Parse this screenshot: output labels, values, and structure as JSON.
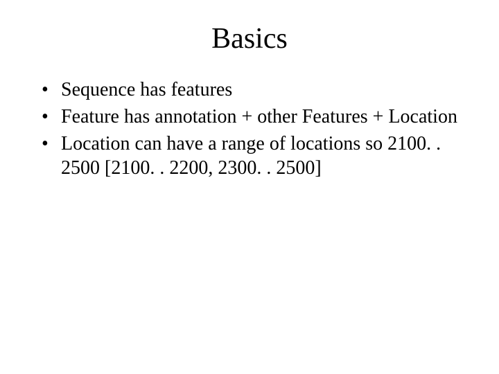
{
  "slide": {
    "title": "Basics",
    "bullets": [
      "Sequence has features",
      "Feature has annotation + other Features + Location",
      "Location can have a range of locations so 2100. . 2500 [2100. . 2200, 2300. . 2500]"
    ]
  }
}
